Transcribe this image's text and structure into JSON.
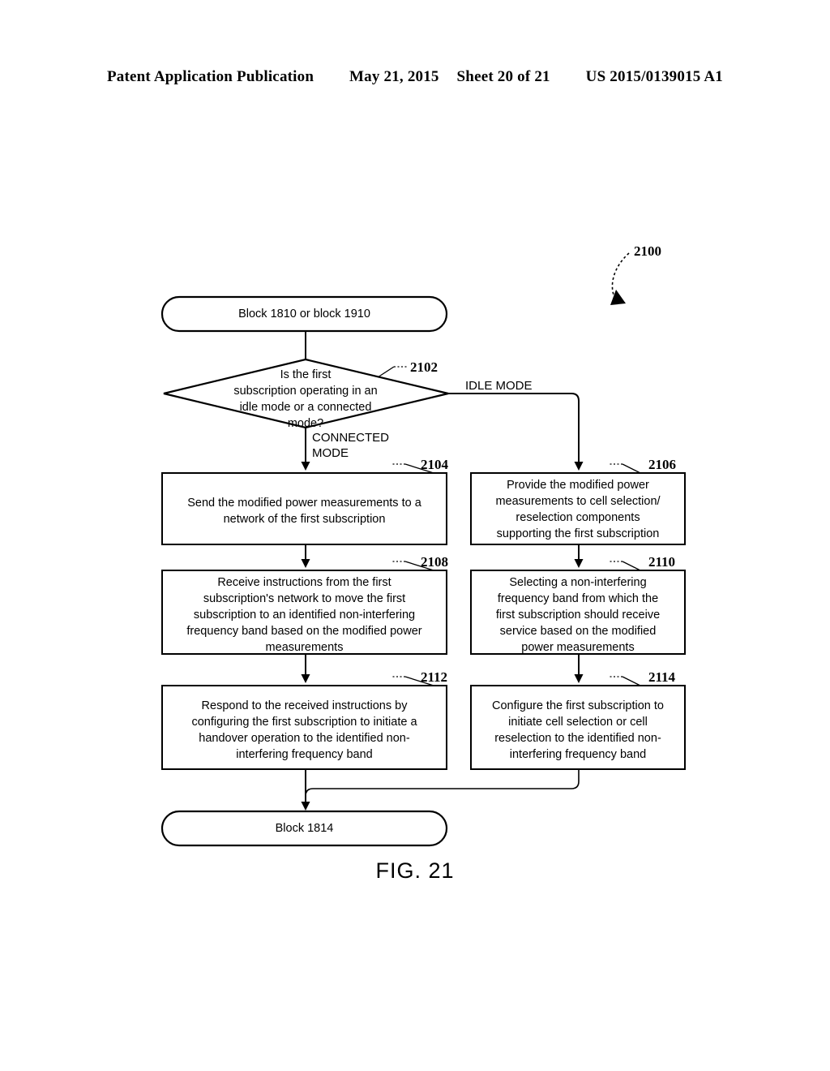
{
  "header": {
    "publication": "Patent Application Publication",
    "date": "May 21, 2015",
    "sheet": "Sheet 20 of 21",
    "patent_number": "US 2015/0139015 A1"
  },
  "figure": {
    "caption": "FIG. 21",
    "diagram_ref": "2100"
  },
  "flowchart": {
    "start_node": {
      "ref": "",
      "text": "Block 1810 or block 1910"
    },
    "decision": {
      "ref": "2102",
      "text": "Is the first\nsubscription operating in an\nidle mode or a connected\nmode?"
    },
    "branches": {
      "idle": "IDLE MODE",
      "connected": "CONNECTED\nMODE"
    },
    "steps": [
      {
        "ref": "2104",
        "column": "left",
        "text": "Send the modified power measurements to a\nnetwork of the first subscription"
      },
      {
        "ref": "2106",
        "column": "right",
        "text": "Provide the modified power\nmeasurements to cell selection/\nreselection components\nsupporting the first subscription"
      },
      {
        "ref": "2108",
        "column": "left",
        "text": "Receive instructions from the first\nsubscription's network to move the first\nsubscription to an identified non-interfering\nfrequency band based on the modified power\nmeasurements"
      },
      {
        "ref": "2110",
        "column": "right",
        "text": "Selecting a non-interfering\nfrequency band from which the\nfirst subscription should receive\nservice based on the modified\npower measurements"
      },
      {
        "ref": "2112",
        "column": "left",
        "text": "Respond to the received instructions by\nconfiguring the first subscription to initiate a\nhandover operation to the identified non-\ninterfering frequency band"
      },
      {
        "ref": "2114",
        "column": "right",
        "text": "Configure the first subscription to\ninitiate cell selection or cell\nreselection to the identified non-\ninterfering frequency band"
      }
    ],
    "end_node": {
      "text": "Block 1814"
    }
  },
  "colors": {
    "ink": "#000000",
    "paper": "#ffffff"
  }
}
